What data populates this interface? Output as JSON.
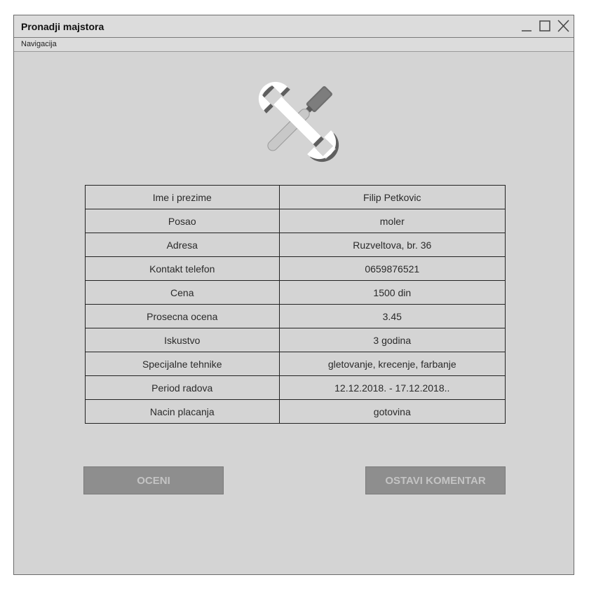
{
  "window": {
    "title": "Pronadji majstora",
    "controls": [
      "minimize-icon",
      "maximize-icon",
      "close-icon"
    ]
  },
  "menubar": {
    "items": [
      {
        "label": "Navigacija"
      }
    ]
  },
  "logo": {
    "icon": "tools-icon"
  },
  "details": {
    "rows": [
      {
        "label": "Ime i prezime",
        "value": "Filip Petkovic"
      },
      {
        "label": "Posao",
        "value": "moler"
      },
      {
        "label": "Adresa",
        "value": "Ruzveltova, br. 36"
      },
      {
        "label": "Kontakt telefon",
        "value": "0659876521"
      },
      {
        "label": "Cena",
        "value": "1500 din"
      },
      {
        "label": "Prosecna ocena",
        "value": "3.45"
      },
      {
        "label": "Iskustvo",
        "value": "3 godina"
      },
      {
        "label": "Specijalne tehnike",
        "value": "gletovanje, krecenje, farbanje"
      },
      {
        "label": "Period radova",
        "value": "12.12.2018. - 17.12.2018.."
      },
      {
        "label": "Nacin placanja",
        "value": "gotovina"
      }
    ]
  },
  "actions": {
    "rate_label": "OCENI",
    "comment_label": "OSTAVI KOMENTAR"
  },
  "colors": {
    "window_bg": "#d4d4d4",
    "button_bg": "#8e8e8e",
    "button_text": "#c4c4c4"
  }
}
